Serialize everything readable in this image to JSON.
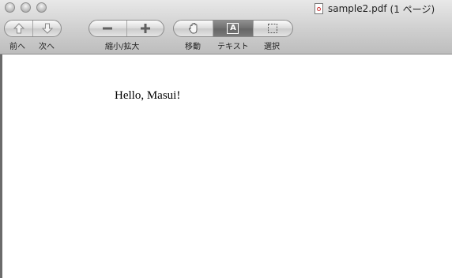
{
  "window": {
    "file_name": "sample2.pdf",
    "page_info": "(1 ページ)"
  },
  "toolbar": {
    "prev_label": "前へ",
    "next_label": "次へ",
    "zoom_label": "縮小/拡大",
    "move_label": "移動",
    "text_label": "テキスト",
    "select_label": "選択",
    "text_icon_glyph": "A"
  },
  "document": {
    "body_text": "Hello, Masui!"
  },
  "icons": [
    "prev-arrow-up-icon",
    "next-arrow-down-icon",
    "zoom-out-icon",
    "zoom-in-icon",
    "hand-icon",
    "text-tool-icon",
    "selection-marquee-icon",
    "pdf-document-icon"
  ]
}
